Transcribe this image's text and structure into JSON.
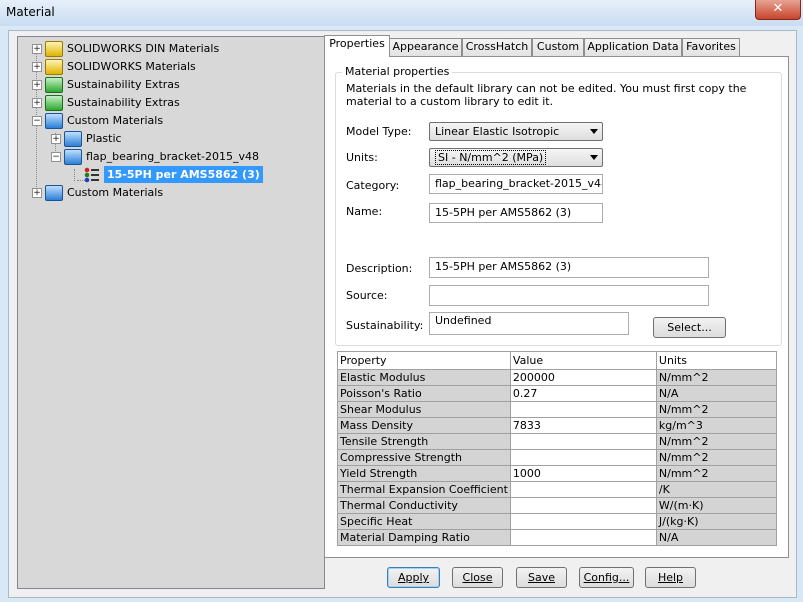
{
  "window": {
    "title": "Material",
    "close_glyph": "✕"
  },
  "tree": {
    "items": [
      {
        "label": "SOLIDWORKS DIN Materials",
        "expander": "+",
        "icon": "library-yellow-icon"
      },
      {
        "label": "SOLIDWORKS Materials",
        "expander": "+",
        "icon": "library-yellow-icon"
      },
      {
        "label": "Sustainability Extras",
        "expander": "+",
        "icon": "library-green-icon"
      },
      {
        "label": "Sustainability Extras",
        "expander": "+",
        "icon": "library-green-icon"
      },
      {
        "label": "Custom Materials",
        "expander": "−",
        "icon": "library-blue-icon"
      },
      {
        "label": "Plastic",
        "expander": "+",
        "icon": "category-blue-icon"
      },
      {
        "label": "flap_bearing_bracket-2015_v48",
        "expander": "−",
        "icon": "category-blue-icon"
      },
      {
        "label": "15-5PH per AMS5862 (3)",
        "expander": "",
        "icon": "material-icon",
        "selected": true
      },
      {
        "label": "Custom Materials",
        "expander": "+",
        "icon": "library-blue-icon"
      }
    ]
  },
  "tabs": [
    "Properties",
    "Appearance",
    "CrossHatch",
    "Custom",
    "Application Data",
    "Favorites"
  ],
  "active_tab": "Properties",
  "properties": {
    "group_title": "Material properties",
    "note": "Materials in the default library can not be edited. You must first copy the material to a custom library to edit it.",
    "model_type_label": "Model Type:",
    "model_type_value": "Linear Elastic Isotropic",
    "units_label": "Units:",
    "units_value": "SI - N/mm^2 (MPa)",
    "category_label": "Category:",
    "category_value": "flap_bearing_bracket-2015_v48",
    "name_label": "Name:",
    "name_value": "15-5PH per AMS5862 (3)",
    "description_label": "Description:",
    "description_value": "15-5PH per AMS5862 (3)",
    "source_label": "Source:",
    "source_value": "",
    "sustainability_label": "Sustainability:",
    "sustainability_value": "Undefined",
    "select_button": "Select..."
  },
  "table": {
    "headers": [
      "Property",
      "Value",
      "Units"
    ],
    "rows": [
      {
        "property": "Elastic Modulus",
        "value": "200000",
        "units": "N/mm^2"
      },
      {
        "property": "Poisson's Ratio",
        "value": "0.27",
        "units": "N/A"
      },
      {
        "property": "Shear Modulus",
        "value": "",
        "units": "N/mm^2"
      },
      {
        "property": "Mass Density",
        "value": "7833",
        "units": "kg/m^3"
      },
      {
        "property": "Tensile Strength",
        "value": "",
        "units": "N/mm^2"
      },
      {
        "property": "Compressive Strength",
        "value": "",
        "units": "N/mm^2"
      },
      {
        "property": "Yield Strength",
        "value": "1000",
        "units": "N/mm^2"
      },
      {
        "property": "Thermal Expansion Coefficient",
        "value": "",
        "units": "/K"
      },
      {
        "property": "Thermal Conductivity",
        "value": "",
        "units": "W/(m·K)"
      },
      {
        "property": "Specific Heat",
        "value": "",
        "units": "J/(kg·K)"
      },
      {
        "property": "Material Damping Ratio",
        "value": "",
        "units": "N/A"
      }
    ]
  },
  "buttons": {
    "apply": "Apply",
    "close": "Close",
    "save": "Save",
    "config": "Config...",
    "help": "Help"
  }
}
